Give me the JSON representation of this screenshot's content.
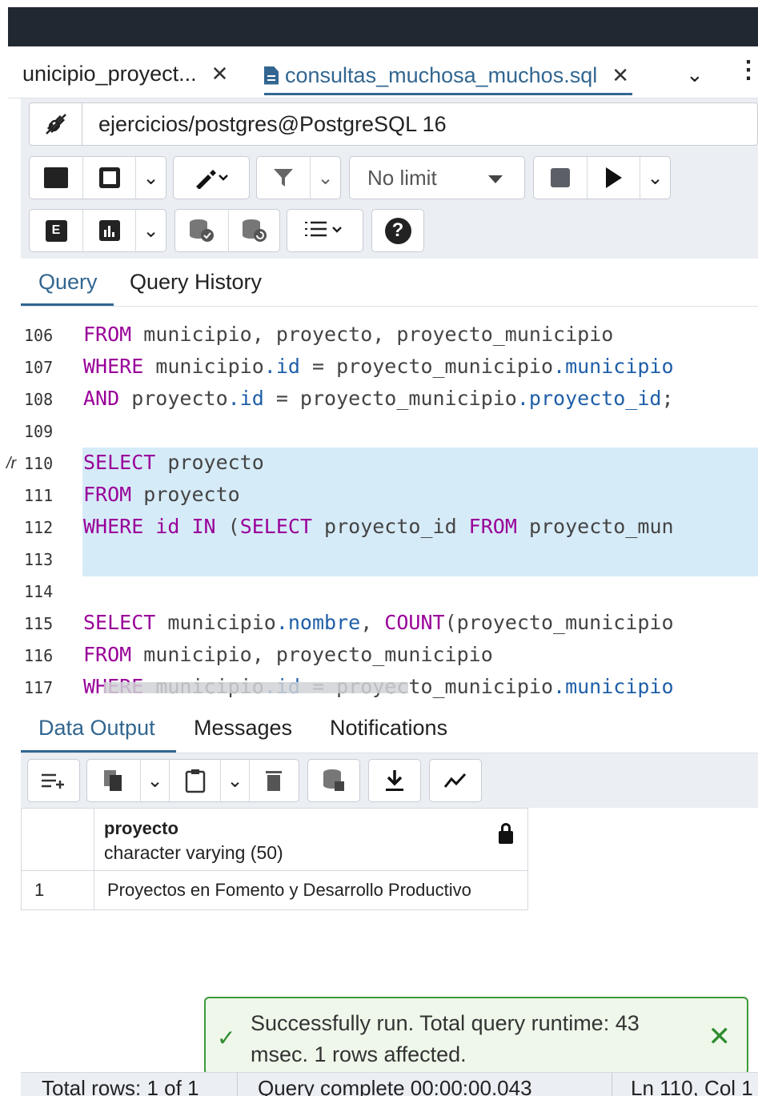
{
  "tabs": [
    {
      "label": "unicipio_proyect...",
      "close": "✕"
    },
    {
      "label": "consultas_muchosa_muchos.sql",
      "close": "✕"
    }
  ],
  "connection": "ejercicios/postgres@PostgreSQL 16",
  "toolbar": {
    "limit_label": "No limit"
  },
  "query_tabs": [
    "Query",
    "Query History"
  ],
  "editor": {
    "cursor_marker": "/r",
    "lines": [
      {
        "num": "106",
        "parts": [
          [
            "kw",
            "FROM"
          ],
          [
            "t",
            " municipio, proyecto, proyecto_municipio"
          ]
        ]
      },
      {
        "num": "107",
        "parts": [
          [
            "kw",
            "WHERE"
          ],
          [
            "t",
            " municipio"
          ],
          [
            "p",
            ".id"
          ],
          [
            "t",
            " = proyecto_municipio"
          ],
          [
            "p",
            ".municipio"
          ]
        ]
      },
      {
        "num": "108",
        "parts": [
          [
            "kw",
            "AND"
          ],
          [
            "t",
            " proyecto"
          ],
          [
            "p",
            ".id"
          ],
          [
            "t",
            " = proyecto_municipio"
          ],
          [
            "p",
            ".proyecto_id"
          ],
          [
            "t",
            ";"
          ]
        ]
      },
      {
        "num": "109",
        "parts": []
      },
      {
        "num": "110",
        "parts": [
          [
            "kw",
            "SELECT"
          ],
          [
            "t",
            " proyecto"
          ]
        ]
      },
      {
        "num": "111",
        "parts": [
          [
            "kw",
            "FROM"
          ],
          [
            "t",
            " proyecto"
          ]
        ]
      },
      {
        "num": "112",
        "parts": [
          [
            "kw",
            "WHERE id IN"
          ],
          [
            "t",
            " ("
          ],
          [
            "kw",
            "SELECT"
          ],
          [
            "t",
            " proyecto_id "
          ],
          [
            "kw",
            "FROM"
          ],
          [
            "t",
            " proyecto_mun"
          ]
        ]
      },
      {
        "num": "113",
        "parts": []
      },
      {
        "num": "114",
        "parts": []
      },
      {
        "num": "115",
        "parts": [
          [
            "kw",
            "SELECT"
          ],
          [
            "t",
            " municipio"
          ],
          [
            "p",
            ".nombre"
          ],
          [
            "t",
            ", "
          ],
          [
            "kw",
            "COUNT"
          ],
          [
            "t",
            "(proyecto_municipio"
          ]
        ]
      },
      {
        "num": "116",
        "parts": [
          [
            "kw",
            "FROM"
          ],
          [
            "t",
            " municipio, proyecto_municipio"
          ]
        ]
      },
      {
        "num": "117",
        "parts": [
          [
            "kw",
            "WHERE"
          ],
          [
            "t",
            " municipio"
          ],
          [
            "p",
            ".id"
          ],
          [
            "t",
            " = proyecto_municipio"
          ],
          [
            "p",
            ".municipio"
          ]
        ]
      }
    ]
  },
  "output_tabs": [
    "Data Output",
    "Messages",
    "Notifications"
  ],
  "grid": {
    "column_name": "proyecto",
    "column_type": "character varying (50)",
    "rows": [
      {
        "num": "1",
        "value": "Proyectos en Fomento y Desarrollo Productivo"
      }
    ]
  },
  "toast": {
    "message": "Successfully run. Total query runtime: 43 msec. 1 rows affected.",
    "close": "✕"
  },
  "status": {
    "total_rows": "Total rows: 1 of 1",
    "query_complete": "Query complete 00:00:00.043",
    "position": "Ln 110, Col 1"
  },
  "colors": {
    "accent": "#326690",
    "keyword": "#990099",
    "property": "#1f5fa8",
    "selection": "#d6ebf8",
    "success": "#3a9b3a"
  }
}
